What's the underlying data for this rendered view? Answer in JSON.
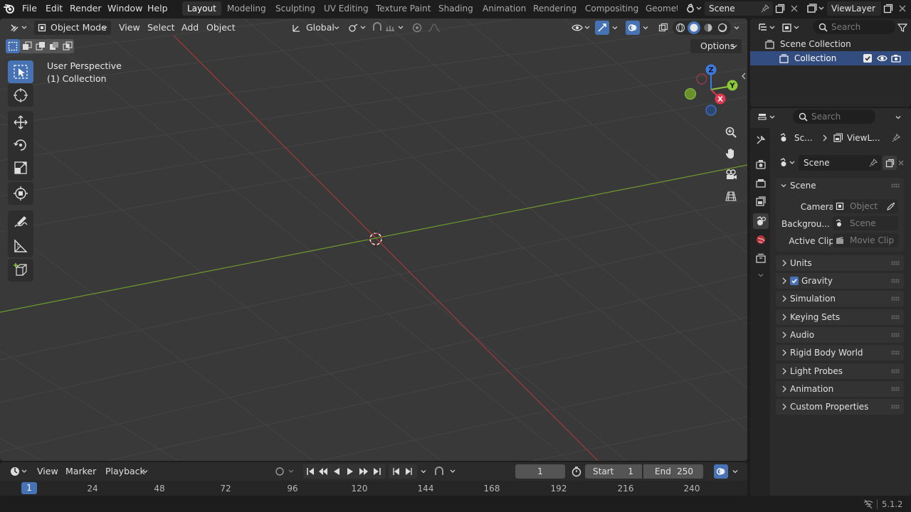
{
  "menu": {
    "items": [
      "File",
      "Edit",
      "Render",
      "Window",
      "Help"
    ]
  },
  "workspaces": [
    "Layout",
    "Modeling",
    "Sculpting",
    "UV Editing",
    "Texture Paint",
    "Shading",
    "Animation",
    "Rendering",
    "Compositing",
    "Geomet"
  ],
  "scene_field": "Scene",
  "viewlayer_field": "ViewLayer",
  "viewport": {
    "mode": "Object Mode",
    "menus": [
      "View",
      "Select",
      "Add",
      "Object"
    ],
    "transform_orientation": "Global",
    "options_label": "Options",
    "overlay_line1": "User Perspective",
    "overlay_line2": "(1) Collection",
    "gizmo_axes": {
      "z": "Z",
      "y": "Y",
      "x": "X"
    },
    "colors": {
      "x_axis": "#a13a3a",
      "y_axis": "#6f9a2b",
      "active_tool": "#4772b3",
      "gizmo_x": "#e0394f",
      "gizmo_y": "#8cc83c",
      "gizmo_z": "#3d7be0"
    }
  },
  "outliner": {
    "search_placeholder": "Search",
    "root": "Scene Collection",
    "collection": "Collection"
  },
  "properties": {
    "search_placeholder": "Search",
    "breadcrumb_scene": "Sc...",
    "breadcrumb_viewlayer": "ViewL...",
    "scene_datablock": "Scene",
    "scene_panel_title": "Scene",
    "camera_label": "Camera",
    "camera_placeholder": "Object",
    "background_label": "Backgrou...",
    "background_placeholder": "Scene",
    "active_clip_label": "Active Clip",
    "active_clip_placeholder": "Movie Clip",
    "panels": [
      "Units",
      "Gravity",
      "Simulation",
      "Keying Sets",
      "Audio",
      "Rigid Body World",
      "Light Probes",
      "Animation",
      "Custom Properties"
    ],
    "gravity_checked": true
  },
  "timeline": {
    "menus": [
      "View",
      "Marker"
    ],
    "playback_label": "Playback",
    "current_frame": "1",
    "start_label": "Start",
    "start_value": "1",
    "end_label": "End",
    "end_value": "250",
    "ruler_current": "1",
    "ruler_ticks": [
      "24",
      "48",
      "72",
      "96",
      "120",
      "144",
      "168",
      "192",
      "216",
      "240"
    ]
  },
  "status": {
    "version": "5.1.2"
  }
}
